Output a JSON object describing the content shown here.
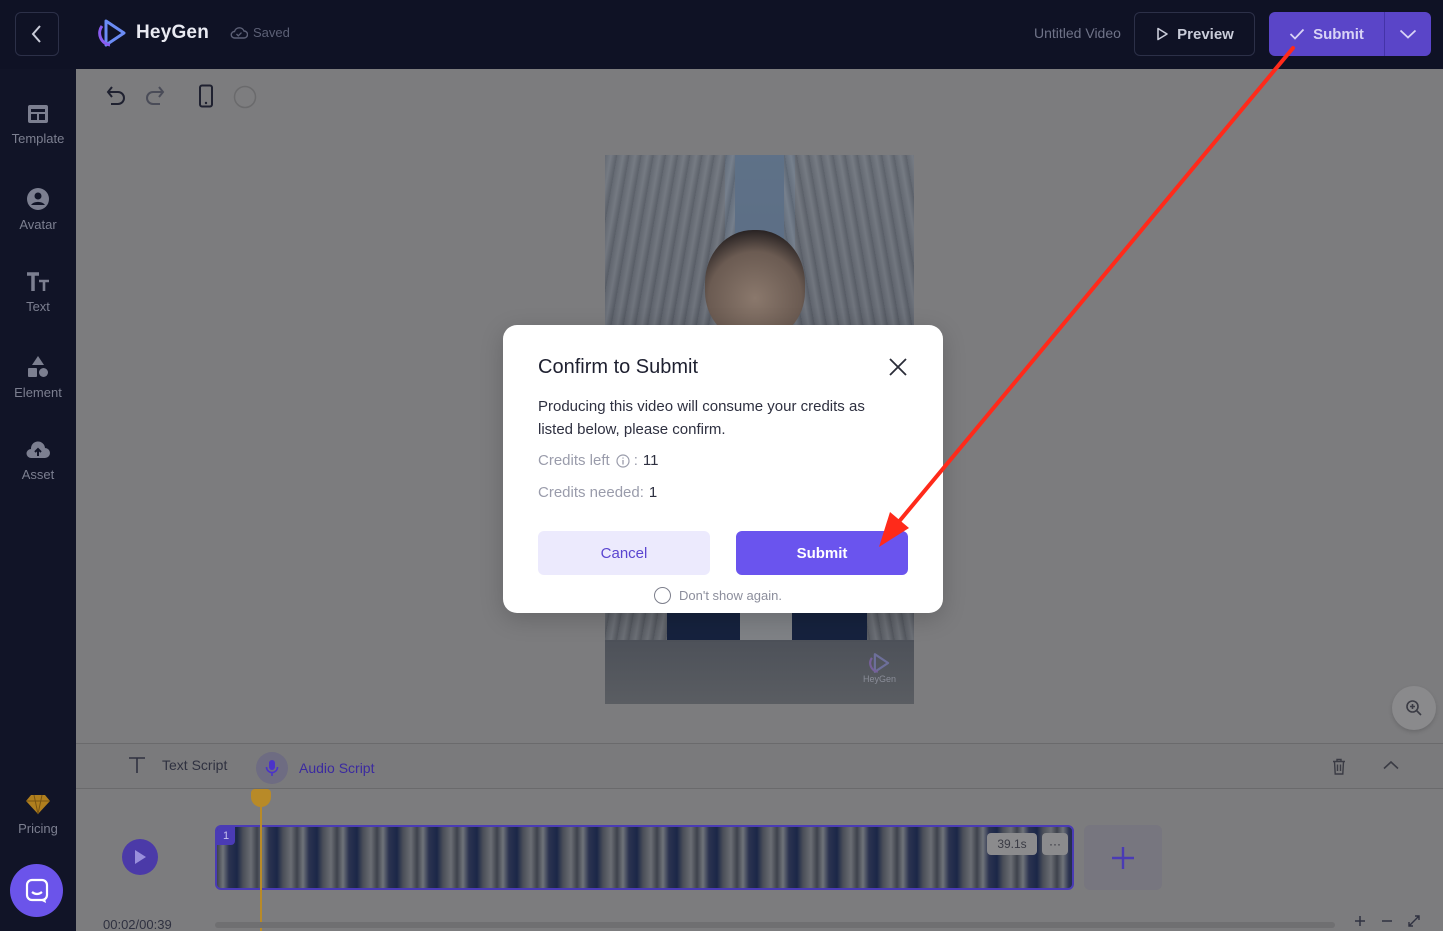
{
  "header": {
    "brand": "HeyGen",
    "saved_status": "Saved",
    "video_title": "Untitled Video",
    "preview_label": "Preview",
    "submit_label": "Submit"
  },
  "sidebar": {
    "items": [
      {
        "label": "Template",
        "icon": "template-icon"
      },
      {
        "label": "Avatar",
        "icon": "avatar-icon"
      },
      {
        "label": "Text",
        "icon": "text-icon"
      },
      {
        "label": "Element",
        "icon": "element-icon"
      },
      {
        "label": "Asset",
        "icon": "asset-icon"
      }
    ],
    "pricing_label": "Pricing"
  },
  "canvas": {
    "watermark": "HeyGen"
  },
  "script_bar": {
    "text_tab": "Text Script",
    "audio_tab": "Audio Script"
  },
  "timeline": {
    "scene_index": "1",
    "duration": "39.1s",
    "more": "···",
    "time": "00:02/00:39"
  },
  "modal": {
    "title": "Confirm to Submit",
    "body": "Producing this video will consume your credits as listed below, please confirm.",
    "credits_left_label": "Credits left",
    "credits_left_sep": ":",
    "credits_left_value": "11",
    "credits_needed_label": "Credits needed:",
    "credits_needed_value": "1",
    "cancel_label": "Cancel",
    "submit_label": "Submit",
    "dont_show_label": "Don't show again."
  },
  "colors": {
    "accent": "#6a54ee",
    "topbar": "#0f1225",
    "annotation": "#ff2a1a"
  }
}
